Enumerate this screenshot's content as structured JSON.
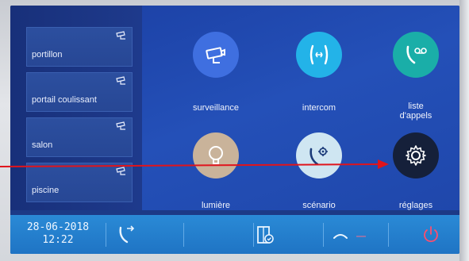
{
  "sidebar": {
    "items": [
      {
        "label": "portillon",
        "icon": "camera-icon"
      },
      {
        "label": "portail coulissant",
        "icon": "camera-icon"
      },
      {
        "label": "salon",
        "icon": "camera-icon"
      },
      {
        "label": "piscine",
        "icon": "camera-icon"
      }
    ]
  },
  "apps": [
    {
      "label": "surveillance",
      "icon": "surveillance-camera-icon",
      "color": "#3f6fe0"
    },
    {
      "label": "intercom",
      "icon": "intercom-phone-icon",
      "color": "#23b3e8"
    },
    {
      "label": "liste\nd'appels",
      "icon": "voicemail-phone-icon",
      "color": "#1aaea8"
    },
    {
      "label": "lumière",
      "icon": "light-bulb-icon",
      "color": "#c9b39a"
    },
    {
      "label": "scénario",
      "icon": "phone-gear-icon",
      "color": "#cfe6f2"
    },
    {
      "label": "réglages",
      "icon": "gear-icon",
      "color": "#15203a"
    }
  ],
  "taskbar": {
    "date": "28-06-2018",
    "time": "12:22",
    "buttons": [
      {
        "name": "call-forward-icon"
      },
      {
        "name": "door-open-icon"
      },
      {
        "name": "unlock-icon"
      },
      {
        "name": "power-icon"
      }
    ]
  },
  "colors": {
    "screen_bg": "#1c3a86",
    "taskbar": "#2a8ad6",
    "arrow": "#e0141c",
    "power": "#ff4d6d"
  }
}
